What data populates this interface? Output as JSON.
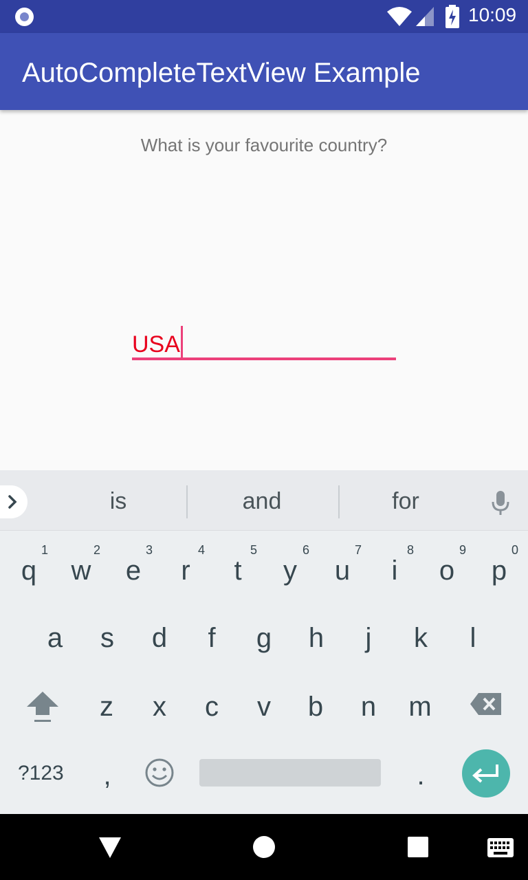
{
  "status_bar": {
    "time": "10:09"
  },
  "app_bar": {
    "title": "AutoCompleteTextView Example"
  },
  "content": {
    "question": "What is your favourite country?",
    "input_value": "USA"
  },
  "keyboard": {
    "suggestions": [
      "is",
      "and",
      "for"
    ],
    "row1": [
      {
        "k": "q",
        "h": "1"
      },
      {
        "k": "w",
        "h": "2"
      },
      {
        "k": "e",
        "h": "3"
      },
      {
        "k": "r",
        "h": "4"
      },
      {
        "k": "t",
        "h": "5"
      },
      {
        "k": "y",
        "h": "6"
      },
      {
        "k": "u",
        "h": "7"
      },
      {
        "k": "i",
        "h": "8"
      },
      {
        "k": "o",
        "h": "9"
      },
      {
        "k": "p",
        "h": "0"
      }
    ],
    "row2": [
      "a",
      "s",
      "d",
      "f",
      "g",
      "h",
      "j",
      "k",
      "l"
    ],
    "row3": [
      "z",
      "x",
      "c",
      "v",
      "b",
      "n",
      "m"
    ],
    "symbols_label": "?123",
    "comma_label": ",",
    "period_label": ".",
    "icons": [
      "chevron-right-icon",
      "microphone-icon",
      "shift-icon",
      "backspace-icon",
      "emoji-icon",
      "enter-icon"
    ]
  },
  "nav_bar": {
    "icons": [
      "back-icon",
      "home-icon",
      "recents-icon",
      "keyboard-icon"
    ]
  }
}
